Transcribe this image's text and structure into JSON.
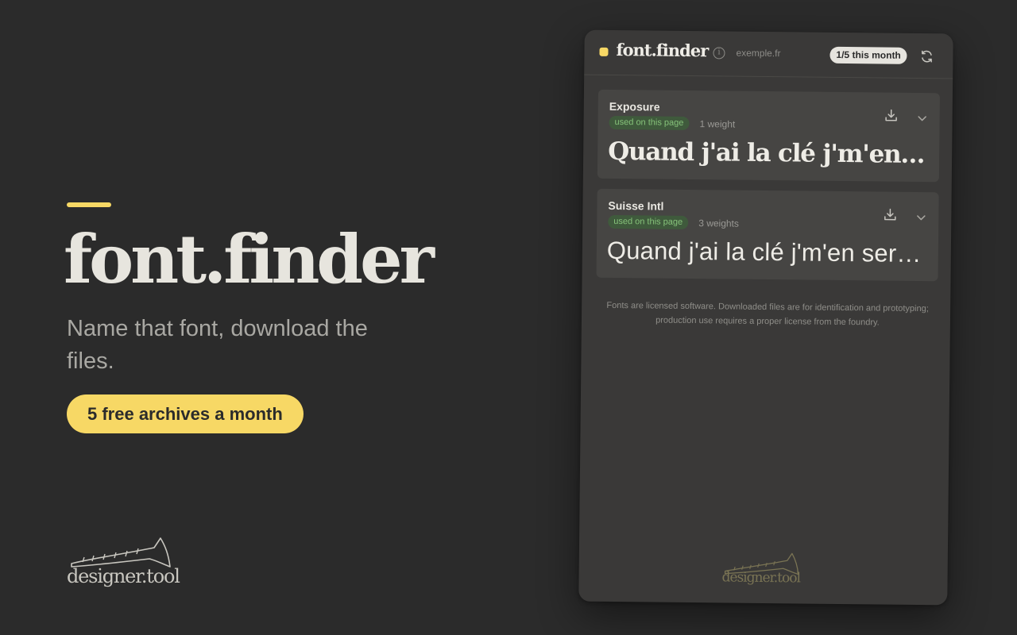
{
  "hero": {
    "title": "font.finder",
    "subtitle": "Name that font, download the files.",
    "cta_label": "5 free archives a month",
    "brand_logo_text": "designer.tool"
  },
  "panel": {
    "title": "font.finder",
    "site_domain": "exemple.fr",
    "quota_badge": "1/5 this month",
    "fonts": [
      {
        "name": "Exposure",
        "usage_badge": "used on this page",
        "weights": "1 weight",
        "preview": "Quand j'ai la clé j'm'en sers pour ouvrir"
      },
      {
        "name": "Suisse Intl",
        "usage_badge": "used on this page",
        "weights": "3 weights",
        "preview": "Quand j'ai la clé j'm'en sers pour ouvrir"
      }
    ],
    "license_note": "Fonts are licensed software. Downloaded files are for identification and prototyping; production use requires a proper license from the foundry.",
    "footer_logo_text": "designer.tool"
  },
  "colors": {
    "background": "#2b2b2b",
    "accent_yellow": "#f7d865",
    "panel_bg": "#3a3938",
    "card_bg": "#464543",
    "badge_green_text": "#86c27a",
    "badge_green_bg": "#3f5a3c"
  },
  "icons": [
    "info-icon",
    "refresh-icon",
    "download-icon",
    "chevron-down-icon",
    "trumpet-logo-icon"
  ]
}
